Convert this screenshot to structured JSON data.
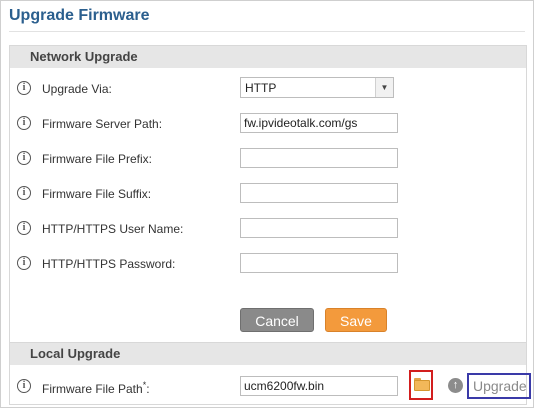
{
  "page": {
    "title": "Upgrade Firmware"
  },
  "network_upgrade": {
    "header": "Network Upgrade",
    "fields": [
      {
        "label": "Upgrade Via:",
        "type": "select",
        "value": "HTTP",
        "arrow_icon": "chevron-down-icon"
      },
      {
        "label": "Firmware Server Path:",
        "type": "text",
        "value": "fw.ipvideotalk.com/gs"
      },
      {
        "label": "Firmware File Prefix:",
        "type": "text",
        "value": ""
      },
      {
        "label": "Firmware File Suffix:",
        "type": "text",
        "value": ""
      },
      {
        "label": "HTTP/HTTPS User Name:",
        "type": "text",
        "value": ""
      },
      {
        "label": "HTTP/HTTPS Password:",
        "type": "text",
        "value": ""
      }
    ],
    "buttons": {
      "cancel_label": "Cancel",
      "save_label": "Save"
    },
    "info_icon": "i"
  },
  "local_upgrade": {
    "header": "Local Upgrade",
    "field": {
      "label": "Firmware File Path",
      "required_mark": "*",
      "label_suffix": ":",
      "value": "ucm6200fw.bin"
    },
    "browse_icon": "folder-icon",
    "upload_icon": "↑",
    "upgrade_label": "Upgrade",
    "info_icon": "i"
  },
  "colors": {
    "title": "#2b5f8e",
    "cancel_button": "#8a8a8a",
    "save_button": "#f39a3c",
    "folder_highlight": "#d21e1e",
    "upgrade_highlight": "#3a3aa8"
  }
}
